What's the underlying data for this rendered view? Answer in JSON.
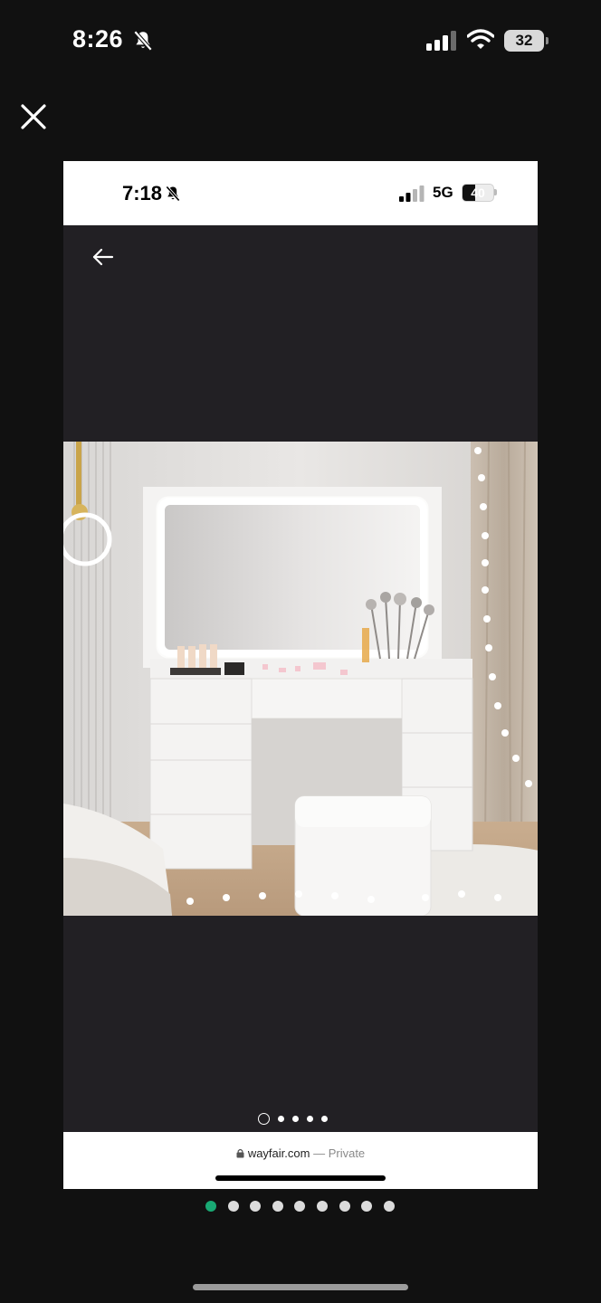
{
  "outer_status": {
    "time": "8:26",
    "battery": "32"
  },
  "inner_screenshot": {
    "status": {
      "time": "7:18",
      "network": "5G",
      "battery": "40",
      "battery_level": 0.4
    },
    "carousel": {
      "total": 5,
      "active_index": 0
    },
    "url_bar": {
      "domain": "wayfair.com",
      "separator": "—",
      "mode": "Private"
    }
  },
  "gallery_pager": {
    "total": 9,
    "active_index": 0,
    "active_color": "#19a974"
  },
  "icons": {
    "close": "close-icon",
    "back": "arrow-left-icon",
    "lock": "lock-icon",
    "bell_off": "bell-off-icon",
    "wifi": "wifi-icon",
    "signal": "signal-icon"
  }
}
